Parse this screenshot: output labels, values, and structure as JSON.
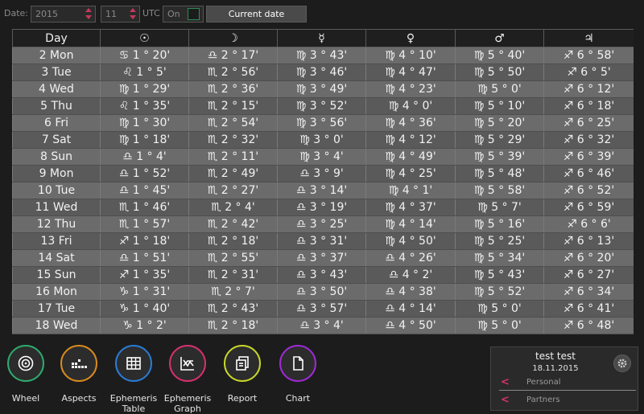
{
  "toolbar": {
    "date_label": "Date:",
    "year": "2015",
    "month": "11",
    "utc_label": "UTC",
    "utc_value": "On",
    "current_date_button": "Current date"
  },
  "table": {
    "headers": [
      "Day",
      "☉",
      "☽",
      "☿",
      "♀",
      "♂",
      "♃"
    ],
    "rows": [
      [
        "2 Mon",
        "♋ 1 ° 20'",
        "♎ 2 ° 17'",
        "♍ 3 ° 43'",
        "♍ 4 ° 10'",
        "♍ 5 ° 40'",
        "♐ 6 ° 58'"
      ],
      [
        "3 Tue",
        "♌ 1 ° 5'",
        "♏ 2 ° 56'",
        "♍ 3 ° 46'",
        "♍ 4 ° 47'",
        "♍ 5 ° 50'",
        "♐ 6 ° 5'"
      ],
      [
        "4 Wed",
        "♍ 1 ° 29'",
        "♏ 2 ° 36'",
        "♍ 3 ° 49'",
        "♍ 4 ° 23'",
        "♍ 5 ° 0'",
        "♐ 6 ° 12'"
      ],
      [
        "5 Thu",
        "♌ 1 ° 35'",
        "♏ 2 ° 15'",
        "♍ 3 ° 52'",
        "♍ 4 ° 0'",
        "♍ 5 ° 10'",
        "♐ 6 ° 18'"
      ],
      [
        "6 Fri",
        "♍ 1 ° 30'",
        "♏ 2 ° 54'",
        "♍ 3 ° 56'",
        "♍ 4 ° 36'",
        "♍ 5 ° 20'",
        "♐ 6 ° 25'"
      ],
      [
        "7 Sat",
        "♍ 1 ° 18'",
        "♏ 2 ° 32'",
        "♍ 3 ° 0'",
        "♍ 4 ° 12'",
        "♍ 5 ° 29'",
        "♐ 6 ° 32'"
      ],
      [
        "8 Sun",
        "♎ 1 ° 4'",
        "♏ 2 ° 11'",
        "♍ 3 ° 4'",
        "♍ 4 ° 49'",
        "♍ 5 ° 39'",
        "♐ 6 ° 39'"
      ],
      [
        "9 Mon",
        "♎ 1 ° 52'",
        "♏ 2 ° 49'",
        "♎ 3 ° 9'",
        "♍ 4 ° 25'",
        "♍ 5 ° 48'",
        "♐ 6 ° 46'"
      ],
      [
        "10 Tue",
        "♎ 1 ° 45'",
        "♏ 2 ° 27'",
        "♎ 3 ° 14'",
        "♍ 4 ° 1'",
        "♍ 5 ° 58'",
        "♐ 6 ° 52'"
      ],
      [
        "11 Wed",
        "♏ 1 ° 46'",
        "♏ 2 ° 4'",
        "♎ 3 ° 19'",
        "♍ 4 ° 37'",
        "♍ 5 ° 7'",
        "♐ 6 ° 59'"
      ],
      [
        "12 Thu",
        "♏ 1 ° 57'",
        "♏ 2 ° 42'",
        "♎ 3 ° 25'",
        "♍ 4 ° 14'",
        "♍ 5 ° 16'",
        "♐ 6 ° 6'"
      ],
      [
        "13 Fri",
        "♐ 1 ° 18'",
        "♏ 2 ° 18'",
        "♎ 3 ° 31'",
        "♍ 4 ° 50'",
        "♍ 5 ° 25'",
        "♐ 6 ° 13'"
      ],
      [
        "14 Sat",
        "♎ 1 ° 51'",
        "♏ 2 ° 55'",
        "♎ 3 ° 37'",
        "♎ 4 ° 26'",
        "♍ 5 ° 34'",
        "♐ 6 ° 20'"
      ],
      [
        "15 Sun",
        "♐ 1 ° 35'",
        "♏ 2 ° 31'",
        "♎ 3 ° 43'",
        "♎ 4 ° 2'",
        "♍ 5 ° 43'",
        "♐ 6 ° 27'"
      ],
      [
        "16 Mon",
        "♑ 1 ° 31'",
        "♏ 2 ° 7'",
        "♎ 3 ° 50'",
        "♎ 4 ° 38'",
        "♍ 5 ° 52'",
        "♐ 6 ° 34'"
      ],
      [
        "17 Tue",
        "♑ 1 ° 40'",
        "♏ 2 ° 43'",
        "♎ 3 ° 57'",
        "♎ 4 ° 14'",
        "♍ 5 ° 0'",
        "♐ 6 ° 41'"
      ],
      [
        "18 Wed",
        "♑ 1 ° 2'",
        "♏ 2 ° 18'",
        "♎ 3 ° 4'",
        "♎ 4 ° 50'",
        "♍ 5 ° 0'",
        "♐ 6 ° 48'"
      ]
    ]
  },
  "dock": {
    "apps": [
      {
        "label": "Wheel",
        "icon": "wheel-icon",
        "color": "#2eaa6e"
      },
      {
        "label": "Aspects",
        "icon": "aspects-icon",
        "color": "#d98a1e"
      },
      {
        "label": "Ephemeris Table",
        "icon": "table-icon",
        "color": "#2a7bd6"
      },
      {
        "label": "Ephemeris Graph",
        "icon": "graph-icon",
        "color": "#d6306e"
      },
      {
        "label": "Report",
        "icon": "report-icon",
        "color": "#c7d62a"
      },
      {
        "label": "Chart",
        "icon": "chart-doc-icon",
        "color": "#a02ad6"
      }
    ]
  },
  "profile": {
    "name": "test test",
    "date": "18.11.2015",
    "personal_label": "Personal",
    "partners_label": "Partners"
  }
}
